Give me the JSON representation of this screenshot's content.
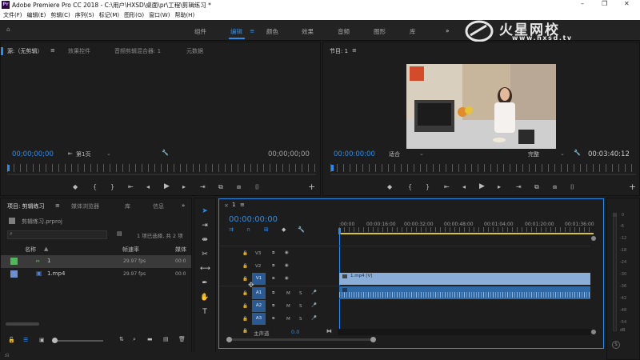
{
  "window": {
    "title": "Adobe Premiere Pro CC 2018 - C:\\用户\\HXSD\\桌面\\pr\\工程\\剪辑练习 *",
    "app_icon_text": "Pr",
    "controls": [
      "–",
      "❐",
      "✕"
    ]
  },
  "menu": [
    "文件(F)",
    "编辑(E)",
    "剪辑(C)",
    "序列(S)",
    "标记(M)",
    "图形(G)",
    "窗口(W)",
    "帮助(H)"
  ],
  "workspaces": {
    "items": [
      "组件",
      "编辑",
      "颜色",
      "效果",
      "音频",
      "图形",
      "库"
    ],
    "active_index": 1,
    "more": "»"
  },
  "watermark": {
    "brand": "火星网校",
    "url": "www.hxsd.tv"
  },
  "source_panel": {
    "tabs": [
      "源:（无剪辑）",
      "效果控件",
      "音频剪辑混合器: 1",
      "元数据"
    ],
    "timecode_left": "00;00;00;00",
    "page_label": "第1页",
    "timecode_right": "00;00;00;00",
    "add": "+"
  },
  "program_panel": {
    "tab": "节目: 1",
    "timecode_left": "00:00:00:00",
    "fit_label": "适合",
    "quality_label": "完整",
    "timecode_right": "00:03:40:12",
    "add": "+"
  },
  "project_panel": {
    "tabs": [
      "项目: 剪辑练习",
      "媒体浏览器",
      "库",
      "信息"
    ],
    "file": "剪辑练习.prproj",
    "selection_info": "1 项已选择, 共 2 项",
    "columns": [
      "名称",
      "帧速率",
      "媒体"
    ],
    "items": [
      {
        "name": "1",
        "fps": "29.97 fps",
        "media": "00:0",
        "color": "#52b65a"
      },
      {
        "name": "1.mp4",
        "fps": "29.97 fps",
        "media": "00:0",
        "color": "#6b8fd0"
      }
    ]
  },
  "timeline": {
    "tab": "1",
    "timecode": "00:00:00:00",
    "ruler": [
      ":00:00",
      "00:00:16:00",
      "00:00:32:00",
      "00:00:48:00",
      "00:01:04:00",
      "00:01:20:00",
      "00:01:36:00"
    ],
    "video_tracks": [
      "V3",
      "V2",
      "V1"
    ],
    "audio_tracks": [
      "A1",
      "A2",
      "A3"
    ],
    "master_label": "主声道",
    "master_value": "0.0",
    "clip_label": "1.mp4 [V]",
    "m_label": "M",
    "s_label": "S"
  },
  "meter": {
    "labels": [
      "0",
      "-6",
      "-12",
      "-18",
      "-24",
      "-30",
      "-36",
      "-42",
      "-48",
      "-54",
      "dB"
    ],
    "btn": "S"
  },
  "colors": {
    "accent": "#2d8ceb",
    "video_clip": "#8aaed8",
    "audio_clip": "#2f6aa6"
  }
}
